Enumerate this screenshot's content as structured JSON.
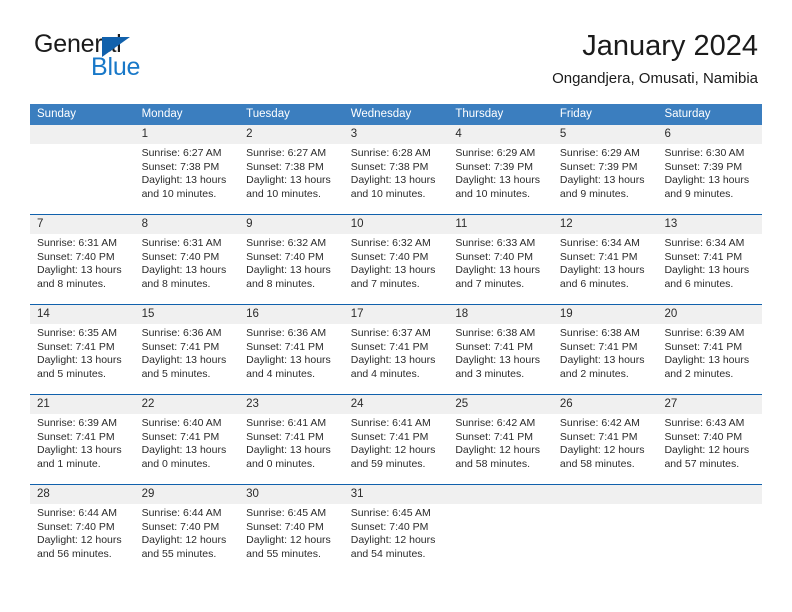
{
  "logo": {
    "word_top": "General",
    "word_bottom": "Blue",
    "triangle_icon": "triangle-icon",
    "color_dark": "#1b1b1b",
    "color_blue": "#1878c8"
  },
  "header": {
    "title": "January 2024",
    "subtitle": "Ongandjera, Omusati, Namibia"
  },
  "theme": {
    "header_bg": "#3b7ebf",
    "week_divider": "#1161ac",
    "daynum_bg": "#f0f0f0",
    "text": "#2b2b2b"
  },
  "calendar": {
    "day_headers": [
      "Sunday",
      "Monday",
      "Tuesday",
      "Wednesday",
      "Thursday",
      "Friday",
      "Saturday"
    ],
    "weeks": [
      {
        "days": [
          {
            "num": "",
            "line1": "",
            "line2": "",
            "line3": "",
            "line4": ""
          },
          {
            "num": "1",
            "line1": "Sunrise: 6:27 AM",
            "line2": "Sunset: 7:38 PM",
            "line3": "Daylight: 13 hours",
            "line4": "and 10 minutes."
          },
          {
            "num": "2",
            "line1": "Sunrise: 6:27 AM",
            "line2": "Sunset: 7:38 PM",
            "line3": "Daylight: 13 hours",
            "line4": "and 10 minutes."
          },
          {
            "num": "3",
            "line1": "Sunrise: 6:28 AM",
            "line2": "Sunset: 7:38 PM",
            "line3": "Daylight: 13 hours",
            "line4": "and 10 minutes."
          },
          {
            "num": "4",
            "line1": "Sunrise: 6:29 AM",
            "line2": "Sunset: 7:39 PM",
            "line3": "Daylight: 13 hours",
            "line4": "and 10 minutes."
          },
          {
            "num": "5",
            "line1": "Sunrise: 6:29 AM",
            "line2": "Sunset: 7:39 PM",
            "line3": "Daylight: 13 hours",
            "line4": "and 9 minutes."
          },
          {
            "num": "6",
            "line1": "Sunrise: 6:30 AM",
            "line2": "Sunset: 7:39 PM",
            "line3": "Daylight: 13 hours",
            "line4": "and 9 minutes."
          }
        ]
      },
      {
        "days": [
          {
            "num": "7",
            "line1": "Sunrise: 6:31 AM",
            "line2": "Sunset: 7:40 PM",
            "line3": "Daylight: 13 hours",
            "line4": "and 8 minutes."
          },
          {
            "num": "8",
            "line1": "Sunrise: 6:31 AM",
            "line2": "Sunset: 7:40 PM",
            "line3": "Daylight: 13 hours",
            "line4": "and 8 minutes."
          },
          {
            "num": "9",
            "line1": "Sunrise: 6:32 AM",
            "line2": "Sunset: 7:40 PM",
            "line3": "Daylight: 13 hours",
            "line4": "and 8 minutes."
          },
          {
            "num": "10",
            "line1": "Sunrise: 6:32 AM",
            "line2": "Sunset: 7:40 PM",
            "line3": "Daylight: 13 hours",
            "line4": "and 7 minutes."
          },
          {
            "num": "11",
            "line1": "Sunrise: 6:33 AM",
            "line2": "Sunset: 7:40 PM",
            "line3": "Daylight: 13 hours",
            "line4": "and 7 minutes."
          },
          {
            "num": "12",
            "line1": "Sunrise: 6:34 AM",
            "line2": "Sunset: 7:41 PM",
            "line3": "Daylight: 13 hours",
            "line4": "and 6 minutes."
          },
          {
            "num": "13",
            "line1": "Sunrise: 6:34 AM",
            "line2": "Sunset: 7:41 PM",
            "line3": "Daylight: 13 hours",
            "line4": "and 6 minutes."
          }
        ]
      },
      {
        "days": [
          {
            "num": "14",
            "line1": "Sunrise: 6:35 AM",
            "line2": "Sunset: 7:41 PM",
            "line3": "Daylight: 13 hours",
            "line4": "and 5 minutes."
          },
          {
            "num": "15",
            "line1": "Sunrise: 6:36 AM",
            "line2": "Sunset: 7:41 PM",
            "line3": "Daylight: 13 hours",
            "line4": "and 5 minutes."
          },
          {
            "num": "16",
            "line1": "Sunrise: 6:36 AM",
            "line2": "Sunset: 7:41 PM",
            "line3": "Daylight: 13 hours",
            "line4": "and 4 minutes."
          },
          {
            "num": "17",
            "line1": "Sunrise: 6:37 AM",
            "line2": "Sunset: 7:41 PM",
            "line3": "Daylight: 13 hours",
            "line4": "and 4 minutes."
          },
          {
            "num": "18",
            "line1": "Sunrise: 6:38 AM",
            "line2": "Sunset: 7:41 PM",
            "line3": "Daylight: 13 hours",
            "line4": "and 3 minutes."
          },
          {
            "num": "19",
            "line1": "Sunrise: 6:38 AM",
            "line2": "Sunset: 7:41 PM",
            "line3": "Daylight: 13 hours",
            "line4": "and 2 minutes."
          },
          {
            "num": "20",
            "line1": "Sunrise: 6:39 AM",
            "line2": "Sunset: 7:41 PM",
            "line3": "Daylight: 13 hours",
            "line4": "and 2 minutes."
          }
        ]
      },
      {
        "days": [
          {
            "num": "21",
            "line1": "Sunrise: 6:39 AM",
            "line2": "Sunset: 7:41 PM",
            "line3": "Daylight: 13 hours",
            "line4": "and 1 minute."
          },
          {
            "num": "22",
            "line1": "Sunrise: 6:40 AM",
            "line2": "Sunset: 7:41 PM",
            "line3": "Daylight: 13 hours",
            "line4": "and 0 minutes."
          },
          {
            "num": "23",
            "line1": "Sunrise: 6:41 AM",
            "line2": "Sunset: 7:41 PM",
            "line3": "Daylight: 13 hours",
            "line4": "and 0 minutes."
          },
          {
            "num": "24",
            "line1": "Sunrise: 6:41 AM",
            "line2": "Sunset: 7:41 PM",
            "line3": "Daylight: 12 hours",
            "line4": "and 59 minutes."
          },
          {
            "num": "25",
            "line1": "Sunrise: 6:42 AM",
            "line2": "Sunset: 7:41 PM",
            "line3": "Daylight: 12 hours",
            "line4": "and 58 minutes."
          },
          {
            "num": "26",
            "line1": "Sunrise: 6:42 AM",
            "line2": "Sunset: 7:41 PM",
            "line3": "Daylight: 12 hours",
            "line4": "and 58 minutes."
          },
          {
            "num": "27",
            "line1": "Sunrise: 6:43 AM",
            "line2": "Sunset: 7:40 PM",
            "line3": "Daylight: 12 hours",
            "line4": "and 57 minutes."
          }
        ]
      },
      {
        "days": [
          {
            "num": "28",
            "line1": "Sunrise: 6:44 AM",
            "line2": "Sunset: 7:40 PM",
            "line3": "Daylight: 12 hours",
            "line4": "and 56 minutes."
          },
          {
            "num": "29",
            "line1": "Sunrise: 6:44 AM",
            "line2": "Sunset: 7:40 PM",
            "line3": "Daylight: 12 hours",
            "line4": "and 55 minutes."
          },
          {
            "num": "30",
            "line1": "Sunrise: 6:45 AM",
            "line2": "Sunset: 7:40 PM",
            "line3": "Daylight: 12 hours",
            "line4": "and 55 minutes."
          },
          {
            "num": "31",
            "line1": "Sunrise: 6:45 AM",
            "line2": "Sunset: 7:40 PM",
            "line3": "Daylight: 12 hours",
            "line4": "and 54 minutes."
          },
          {
            "num": "",
            "line1": "",
            "line2": "",
            "line3": "",
            "line4": ""
          },
          {
            "num": "",
            "line1": "",
            "line2": "",
            "line3": "",
            "line4": ""
          },
          {
            "num": "",
            "line1": "",
            "line2": "",
            "line3": "",
            "line4": ""
          }
        ]
      }
    ]
  }
}
